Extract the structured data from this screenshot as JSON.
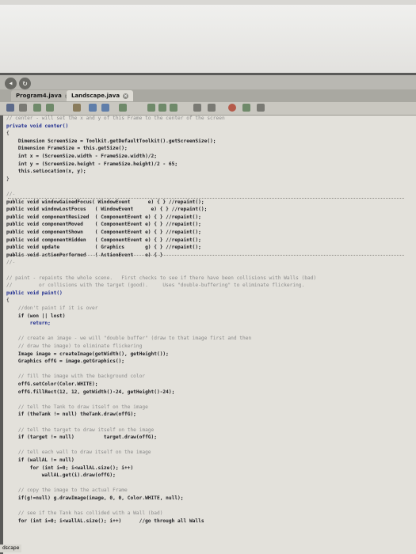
{
  "browser": {
    "nav_icon": "circle-arrow-icon",
    "tabs": [
      {
        "label": "Program4.java"
      },
      {
        "label": "Landscape.java"
      }
    ]
  },
  "editor": {
    "lines": [
      {
        "text": "// center - will set the x and y of this Frame to the center of the screen",
        "cls": "cm"
      },
      {
        "text": "private void center()",
        "cls": "kw"
      },
      {
        "text": "{",
        "cls": ""
      },
      {
        "text": "    Dimension ScreenSize = Toolkit.getDefaultToolkit().getScreenSize();",
        "cls": "bd"
      },
      {
        "text": "    Dimension FrameSize = this.getSize();",
        "cls": "bd"
      },
      {
        "text": "    int x = (ScreenSize.width - FrameSize.width)/2;",
        "cls": "bd"
      },
      {
        "text": "    int y = (ScreenSize.height - FrameSize.height)/2 - 65;",
        "cls": "bd"
      },
      {
        "text": "    this.setLocation(x, y);",
        "cls": "bd"
      },
      {
        "text": "}",
        "cls": ""
      },
      {
        "text": "",
        "cls": ""
      },
      {
        "text": "//-",
        "cls": "cm"
      },
      {
        "text": "public void windowGainedFocus( WindowEvent      e) { } //repaint();",
        "cls": "bd"
      },
      {
        "text": "public void windowLostFocus   ( WindowEvent      e) { } //repaint();",
        "cls": "bd"
      },
      {
        "text": "public void componentResized  ( ComponentEvent e) { } //repaint();",
        "cls": "bd"
      },
      {
        "text": "public void componentMoved    ( ComponentEvent e) { } //repaint();",
        "cls": "bd"
      },
      {
        "text": "public void componentShown    ( ComponentEvent e) { } //repaint();",
        "cls": "bd"
      },
      {
        "text": "public void componentHidden   ( ComponentEvent e) { } //repaint();",
        "cls": "bd"
      },
      {
        "text": "public void update            ( Graphics       g) { } //repaint();",
        "cls": "bd"
      },
      {
        "text": "public void actionPerformed   ( ActionEvent    e) { }",
        "cls": "bd"
      },
      {
        "text": "//-",
        "cls": "cm"
      },
      {
        "text": "",
        "cls": ""
      },
      {
        "text": "// paint - repaints the whole scene.   First checks to see if there have been collisions with Walls (bad)",
        "cls": "cm"
      },
      {
        "text": "//         or collisions with the target (good).     Uses \"double-buffering\" to eliminate flickering.",
        "cls": "cm"
      },
      {
        "text": "public void paint()",
        "cls": "kw"
      },
      {
        "text": "{",
        "cls": ""
      },
      {
        "text": "    //don't paint if it is over",
        "cls": "cm"
      },
      {
        "text": "    if (won || lost)",
        "cls": "bd"
      },
      {
        "text": "        return;",
        "cls": "kw"
      },
      {
        "text": "",
        "cls": ""
      },
      {
        "text": "    // create an image - we will \"double buffer\" (draw to that image first and then",
        "cls": "cm"
      },
      {
        "text": "    // draw the image) to eliminate flickering",
        "cls": "cm"
      },
      {
        "text": "    Image image = createImage(getWidth(), getHeight());",
        "cls": "bd"
      },
      {
        "text": "    Graphics offG = image.getGraphics();",
        "cls": "bd"
      },
      {
        "text": "",
        "cls": ""
      },
      {
        "text": "    // fill the image with the background color",
        "cls": "cm"
      },
      {
        "text": "    offG.setColor(Color.WHITE);",
        "cls": "bd"
      },
      {
        "text": "    offG.fillRect(12, 12, getWidth()-24, getHeight()-24);",
        "cls": "bd"
      },
      {
        "text": "",
        "cls": ""
      },
      {
        "text": "    // tell the Tank to draw itself on the image",
        "cls": "cm"
      },
      {
        "text": "    if (theTank != null) theTank.draw(offG);",
        "cls": "bd"
      },
      {
        "text": "",
        "cls": ""
      },
      {
        "text": "    // tell the target to draw itself on the image",
        "cls": "cm"
      },
      {
        "text": "    if (target != null)          target.draw(offG);",
        "cls": "bd"
      },
      {
        "text": "",
        "cls": ""
      },
      {
        "text": "    // tell each wall to draw itself on the image",
        "cls": "cm"
      },
      {
        "text": "    if (wallAL != null)",
        "cls": "bd"
      },
      {
        "text": "        for (int i=0; i<wallAL.size(); i++)",
        "cls": "bd"
      },
      {
        "text": "            wallAL.get(i).draw(offG);",
        "cls": "bd"
      },
      {
        "text": "",
        "cls": ""
      },
      {
        "text": "    // copy the image to the actual Frame",
        "cls": "cm"
      },
      {
        "text": "    if(g!=null) g.drawImage(image, 0, 0, Color.WHITE, null);",
        "cls": "bd"
      },
      {
        "text": "",
        "cls": ""
      },
      {
        "text": "    // see if the Tank has collided with a Wall (bad)",
        "cls": "cm"
      },
      {
        "text": "    for (int i=0; i<wallAL.size(); i++)      //go through all Walls",
        "cls": "bd"
      }
    ]
  },
  "status_fragment": "dscape"
}
